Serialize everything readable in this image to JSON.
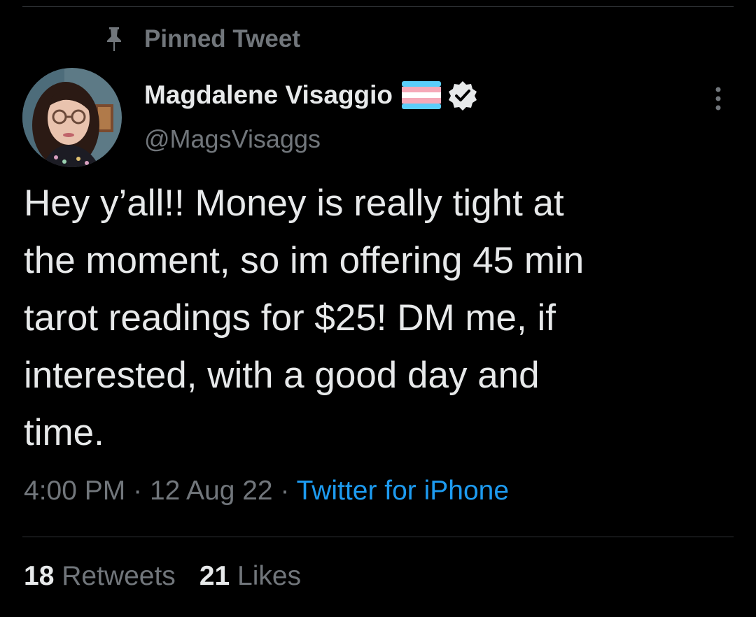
{
  "pinned": {
    "label": "Pinned Tweet",
    "icon": "pin-icon"
  },
  "author": {
    "name": "Magdalene Visaggio",
    "handle": "@MagsVisaggs",
    "flag_icon": "transgender-flag-icon",
    "verified_icon": "verified-badge-icon",
    "flag_colors": [
      "#5BCEFA",
      "#F5A9B8",
      "#FFFFFF"
    ]
  },
  "tweet": {
    "text": "Hey y’all!! Money is really tight at\nthe moment, so im offering 45 min\ntarot readings for $25! DM me, if\ninterested, with a good day and\ntime.",
    "time": "4:00 PM",
    "date": "12 Aug 22",
    "separator": "·",
    "source": "Twitter for iPhone"
  },
  "stats": {
    "retweets_count": "18",
    "retweets_label": "Retweets",
    "likes_count": "21",
    "likes_label": "Likes"
  },
  "colors": {
    "background": "#000000",
    "primary_text": "#e7e9ea",
    "secondary_text": "#71767b",
    "link": "#1d9bf0",
    "divider": "#2f3336"
  },
  "more_menu_icon": "more-vertical-icon"
}
